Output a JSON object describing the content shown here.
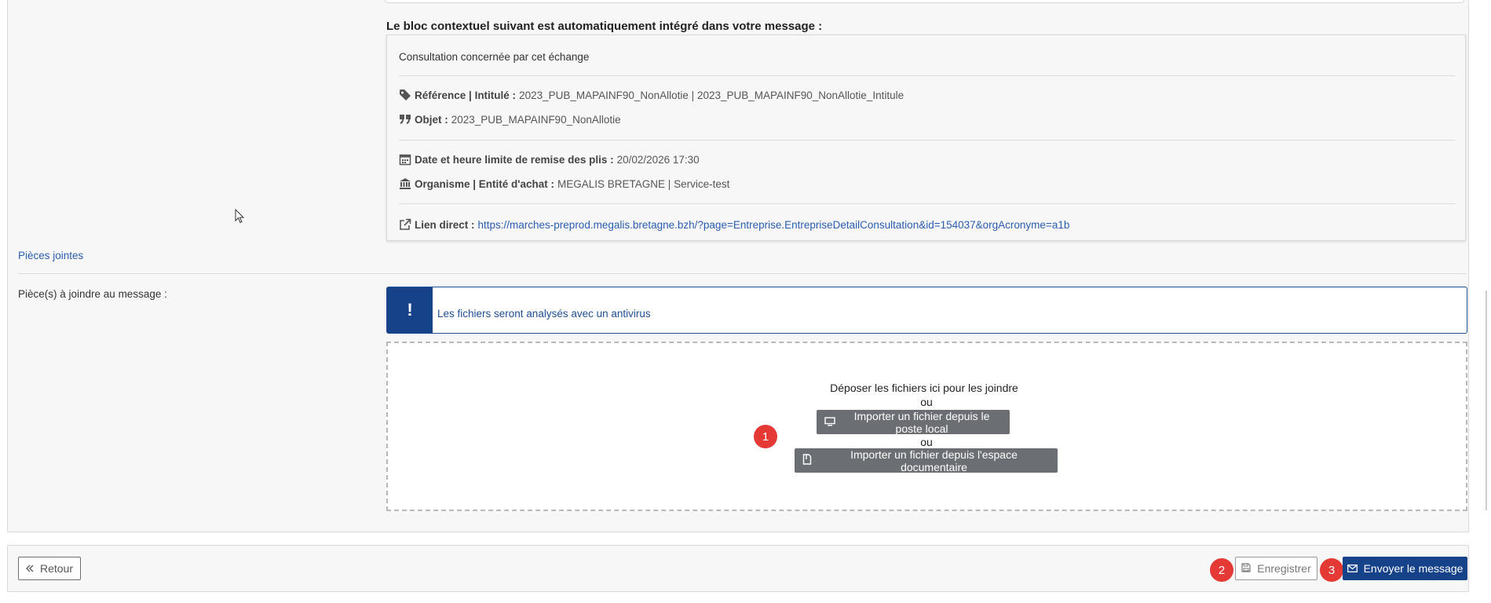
{
  "context": {
    "heading": "Le bloc contextuel suivant est automatiquement intégré dans votre message :",
    "title": "Consultation concernée par cet échange",
    "reference": {
      "label": "Référence | Intitulé :",
      "value": "2023_PUB_MAPAINF90_NonAllotie | 2023_PUB_MAPAINF90_NonAllotie_Intitule",
      "icon": "tag-icon"
    },
    "objet": {
      "label": "Objet :",
      "value": "2023_PUB_MAPAINF90_NonAllotie",
      "icon": "quote-icon"
    },
    "deadline": {
      "label": "Date et heure limite de remise des plis :",
      "value": "20/02/2026 17:30",
      "icon": "calendar-icon"
    },
    "organisme": {
      "label": "Organisme | Entité d'achat :",
      "value": "MEGALIS BRETAGNE | Service-test",
      "icon": "institution-icon"
    },
    "link": {
      "label": "Lien direct :",
      "value": "https://marches-preprod.megalis.bretagne.bzh/?page=Entreprise.EntrepriseDetailConsultation&id=154037&orgAcronyme=a1b",
      "icon": "external-link-icon"
    }
  },
  "attachments": {
    "section_title": "Pièces jointes",
    "field_label": "Pièce(s) à joindre au message :",
    "alert_icon": "!",
    "alert_text": "Les fichiers seront analysés avec un antivirus",
    "dropzone": {
      "drop_text": "Déposer les fichiers ici pour les joindre",
      "or_1": "ou",
      "local_button": "Importer un fichier depuis le poste local",
      "or_2": "ou",
      "docspace_button": "Importer un fichier depuis l'espace documentaire"
    }
  },
  "footer": {
    "back_label": "Retour",
    "save_label": "Enregistrer",
    "send_label": "Envoyer le message"
  },
  "badges": {
    "one": "1",
    "two": "2",
    "three": "3"
  },
  "colors": {
    "primary": "#16428a",
    "link": "#2a5db0",
    "badge": "#e53935",
    "button_dark": "#6b6f73"
  }
}
